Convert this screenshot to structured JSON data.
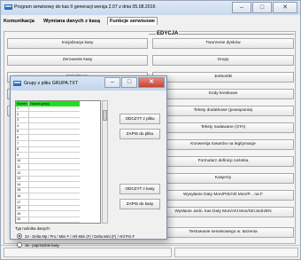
{
  "window": {
    "title": "Program serwisowy do kas II generacji wersja 2.07 z dnia 05.08.2016",
    "minimize": "–",
    "maximize": "□",
    "close": "✕"
  },
  "menu": {
    "items": [
      "Komunikacja",
      "Wymiana danych z kasą",
      "Funkcje serwisowe"
    ]
  },
  "groupbox": {
    "title": "EDYCJA"
  },
  "left_buttons": [
    "Inicjalizacja kasy",
    "Zerowanie kasy",
    "Fiskalizacja",
    "",
    ""
  ],
  "right_buttons": [
    "Tworzenie dysków",
    "Grupy",
    "Jednostki",
    "Kody kreskowe",
    "Teksty dodatkowe (powiązania)",
    "Teksty nadawane (STA)",
    "Konwersja towarów na legitymacje",
    "Formularz definicji nośnika",
    "Kasjerzy",
    "Wysyłanie Daty Mon/Prk/Ahl Mon/P... na F",
    "Wysłanie Jedn. kas Daty Mon/Ahl Mon/Str/Jedn/EN",
    "Testowanie serwisowego w. tarzenia"
  ],
  "dialog": {
    "title": "Grupy z pliku GRUPA.TXT",
    "grid_header": [
      "Numer",
      "Nazwa grupy"
    ],
    "rows": [
      "1",
      "2",
      "3",
      "4",
      "5",
      "6",
      "7",
      "8",
      "9",
      "10",
      "11",
      "12",
      "13",
      "14",
      "15",
      "16",
      "17",
      "18",
      "19",
      "20"
    ],
    "buttons": [
      "ODCZYT z pliku",
      "ZAPIS do pliku",
      "ODCZYT z kasy",
      "ZAPIS do kasy"
    ],
    "type_label": "Typ nośnika danych:",
    "option1": "33 - Delta Mp / Pro / Mini F / Ahl Mini (F) / Delta Mini (F) / Ahl Pro F",
    "option2": "16 - poprzednie kasy"
  },
  "status": {
    "cells": [
      "",
      ""
    ]
  }
}
